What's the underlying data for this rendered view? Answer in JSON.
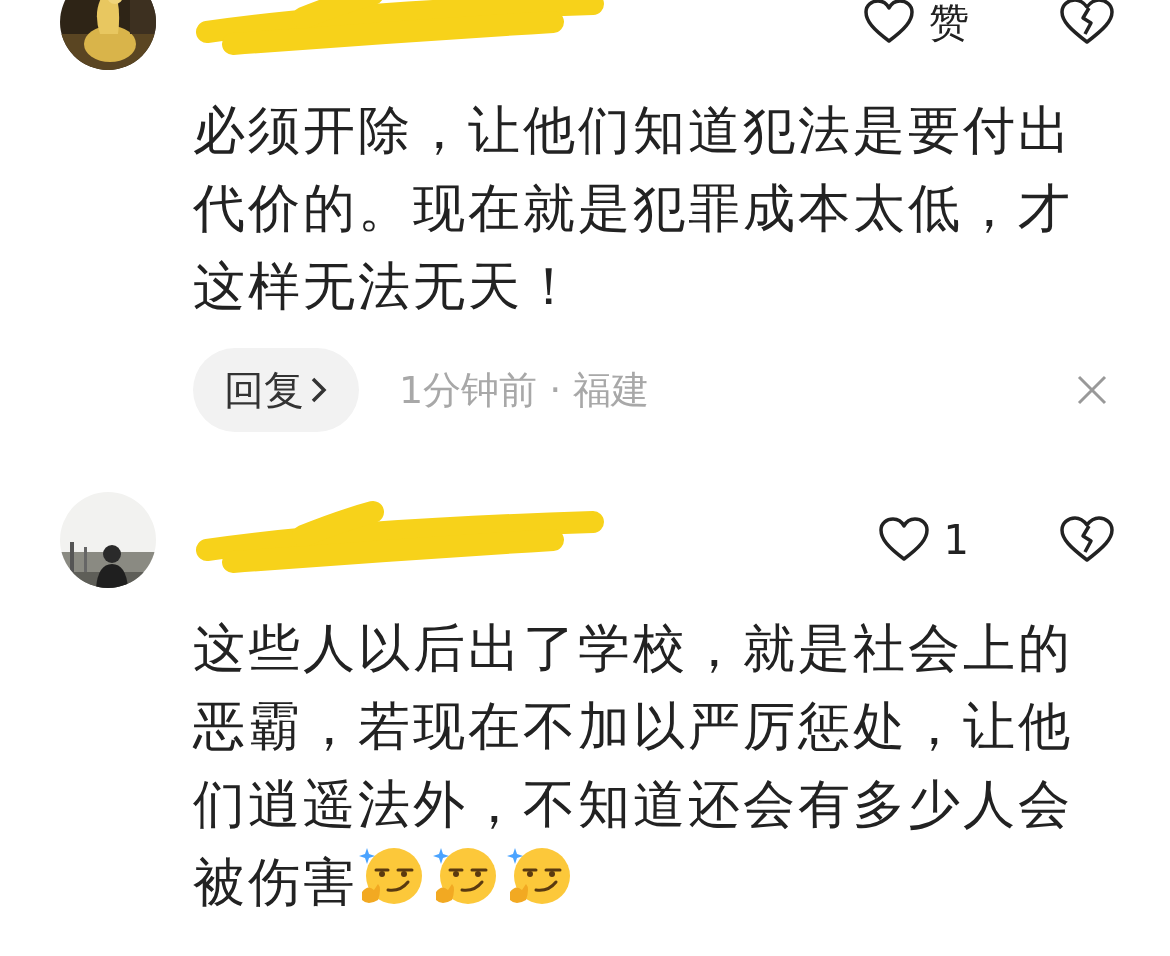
{
  "comments": [
    {
      "like": {
        "label": "赞",
        "liked": false
      },
      "text": "必须开除，让他们知道犯法是要付出代价的。现在就是犯罪成本太低，才这样无法无天！",
      "reply": {
        "label": "回复",
        "meta": "1分钟前 · 福建"
      },
      "dismissible": true
    },
    {
      "like": {
        "label": "1",
        "liked": false
      },
      "text": "这些人以后出了学校，就是社会上的恶霸，若现在不加以严厉惩处，让他们逍遥法外，不知道还会有多少人会被伤害",
      "emojis": [
        {
          "kind": "smirk"
        },
        {
          "kind": "smirk"
        },
        {
          "kind": "smirk"
        }
      ]
    }
  ]
}
